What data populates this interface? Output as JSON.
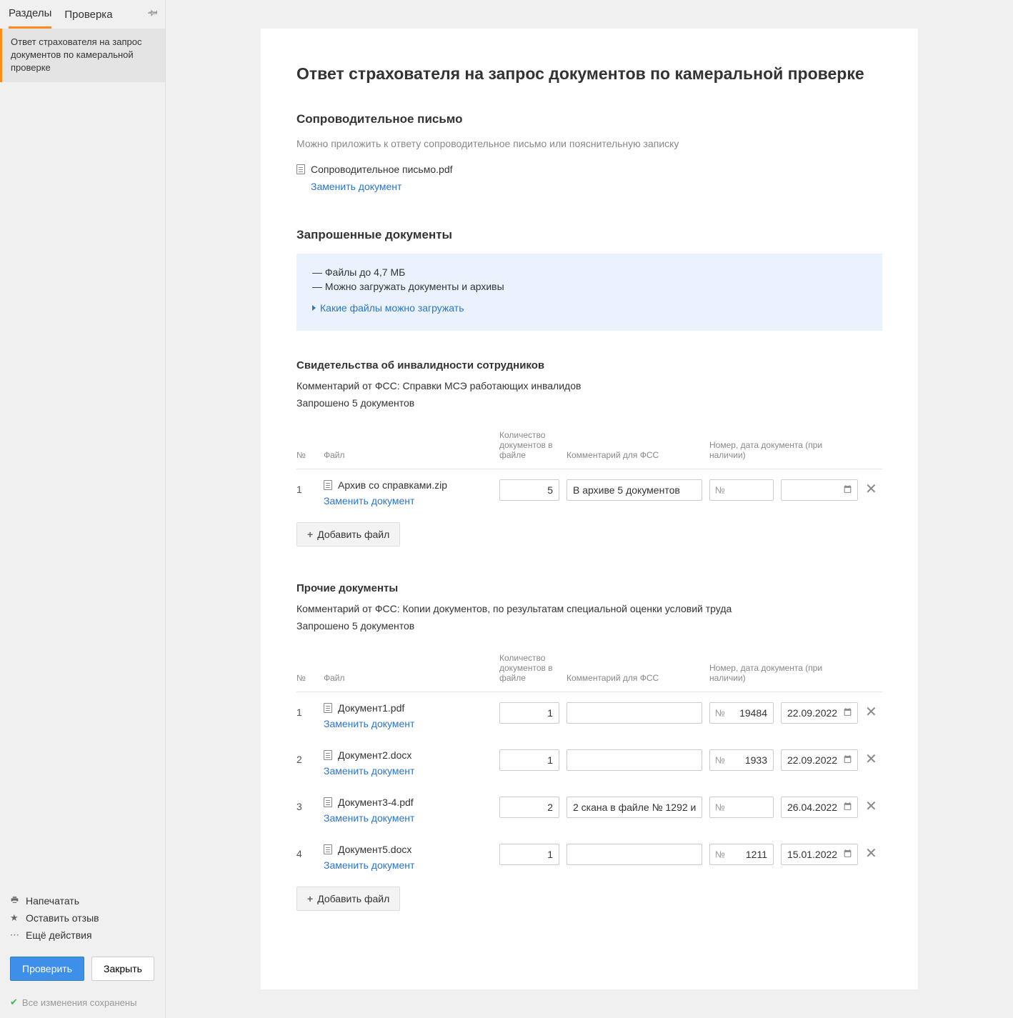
{
  "sidebar": {
    "tabs": [
      "Разделы",
      "Проверка"
    ],
    "item": "Ответ страхователя на запрос документов по камеральной проверке",
    "actions": {
      "print": "Напечатать",
      "feedback": "Оставить отзыв",
      "more": "Ещё действия"
    },
    "buttons": {
      "check": "Проверить",
      "close": "Закрыть"
    },
    "save_status": "Все изменения сохранены"
  },
  "page": {
    "title": "Ответ страхователя на запрос документов по камеральной проверке",
    "cover_letter": {
      "heading": "Сопроводительное письмо",
      "hint": "Можно приложить к ответу сопроводительное письмо или пояснительную записку",
      "filename": "Сопроводительное письмо.pdf",
      "replace": "Заменить документ"
    },
    "requested": {
      "heading": "Запрошенные документы",
      "info1": "— Файлы до 4,7 МБ",
      "info2": "— Можно загружать документы и архивы",
      "expand": "Какие файлы можно загружать"
    },
    "columns": {
      "num": "№",
      "file": "Файл",
      "qty": "Количество документов в файле",
      "comment": "Комментарий для ФСС",
      "docinfo": "Номер, дата документа (при наличии)"
    },
    "docnum_prefix": "№",
    "replace_link": "Заменить документ",
    "add_file": "Добавить файл",
    "section1": {
      "title": "Свидетельства об инвалидности сотрудников",
      "fss_comment": "Комментарий от ФСС: Справки МСЭ работающих инвалидов",
      "requested_count": "Запрошено 5 документов",
      "rows": [
        {
          "num": "1",
          "file": "Архив со справками.zip",
          "qty": "5",
          "comment": "В архиве 5 документов",
          "docnum": "",
          "date": ""
        }
      ]
    },
    "section2": {
      "title": "Прочие документы",
      "fss_comment": "Комментарий от ФСС: Копии документов, по результатам специальной оценки условий труда",
      "requested_count": "Запрошено 5 документов",
      "rows": [
        {
          "num": "1",
          "file": "Документ1.pdf",
          "qty": "1",
          "comment": "",
          "docnum": "19484",
          "date": "22.09.2022"
        },
        {
          "num": "2",
          "file": "Документ2.docx",
          "qty": "1",
          "comment": "",
          "docnum": "1933",
          "date": "22.09.2022"
        },
        {
          "num": "3",
          "file": "Документ3-4.pdf",
          "qty": "2",
          "comment": "2 скана в файле № 1292 и",
          "docnum": "",
          "date": "26.04.2022"
        },
        {
          "num": "4",
          "file": "Документ5.docx",
          "qty": "1",
          "comment": "",
          "docnum": "1211",
          "date": "15.01.2022"
        }
      ]
    }
  }
}
